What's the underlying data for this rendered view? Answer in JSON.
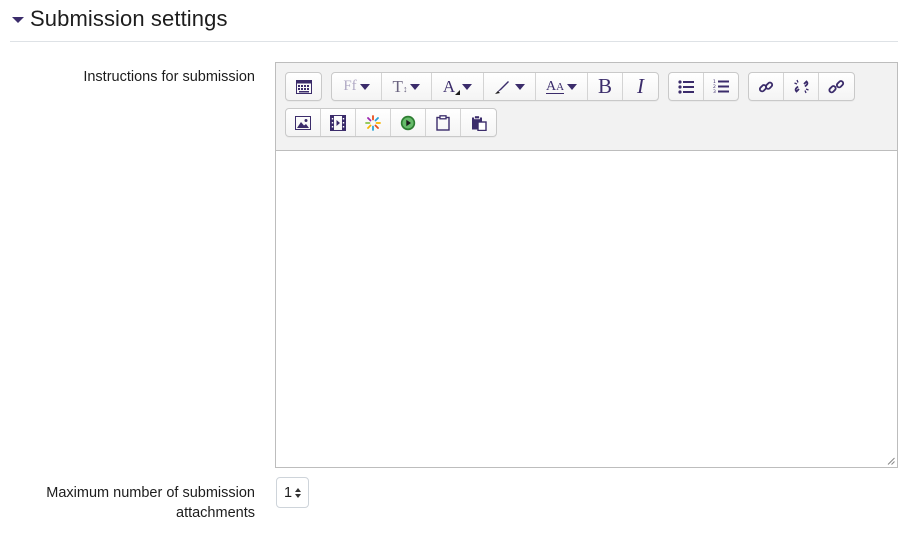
{
  "section": {
    "title": "Submission settings",
    "collapse_icon": "caret-down-icon"
  },
  "instructions": {
    "label": "Instructions for submission",
    "content": ""
  },
  "toolbar": {
    "row1": [
      {
        "group": "collapse",
        "buttons": [
          {
            "name": "show-more-buttons-icon"
          }
        ]
      },
      {
        "group": "style",
        "buttons": [
          {
            "name": "font-family-icon",
            "glyph": "Ff",
            "dropdown": true
          },
          {
            "name": "font-size-icon",
            "glyph": "T",
            "dropdown": true
          },
          {
            "name": "font-color-icon",
            "glyph": "A",
            "dropdown": true
          },
          {
            "name": "background-color-icon",
            "dropdown": true
          },
          {
            "name": "text-style-icon",
            "glyph": "A",
            "dropdown": true
          },
          {
            "name": "bold-icon",
            "glyph": "B"
          },
          {
            "name": "italic-icon",
            "glyph": "I"
          }
        ]
      },
      {
        "group": "list",
        "buttons": [
          {
            "name": "unordered-list-icon"
          },
          {
            "name": "ordered-list-icon"
          }
        ]
      },
      {
        "group": "links",
        "buttons": [
          {
            "name": "link-icon"
          },
          {
            "name": "unlink-icon"
          },
          {
            "name": "anchor-link-icon"
          }
        ]
      }
    ],
    "row2": [
      {
        "group": "media",
        "buttons": [
          {
            "name": "insert-image-icon"
          },
          {
            "name": "insert-media-icon"
          },
          {
            "name": "manage-files-icon"
          },
          {
            "name": "record-video-icon"
          },
          {
            "name": "copy-icon"
          },
          {
            "name": "paste-icon"
          }
        ]
      }
    ]
  },
  "attachments": {
    "label": "Maximum number of submission attachments",
    "value": "1"
  },
  "colors": {
    "accent": "#3b2c6b",
    "toolbar_bg": "#f2f2f2",
    "border": "#bdbdbd"
  }
}
